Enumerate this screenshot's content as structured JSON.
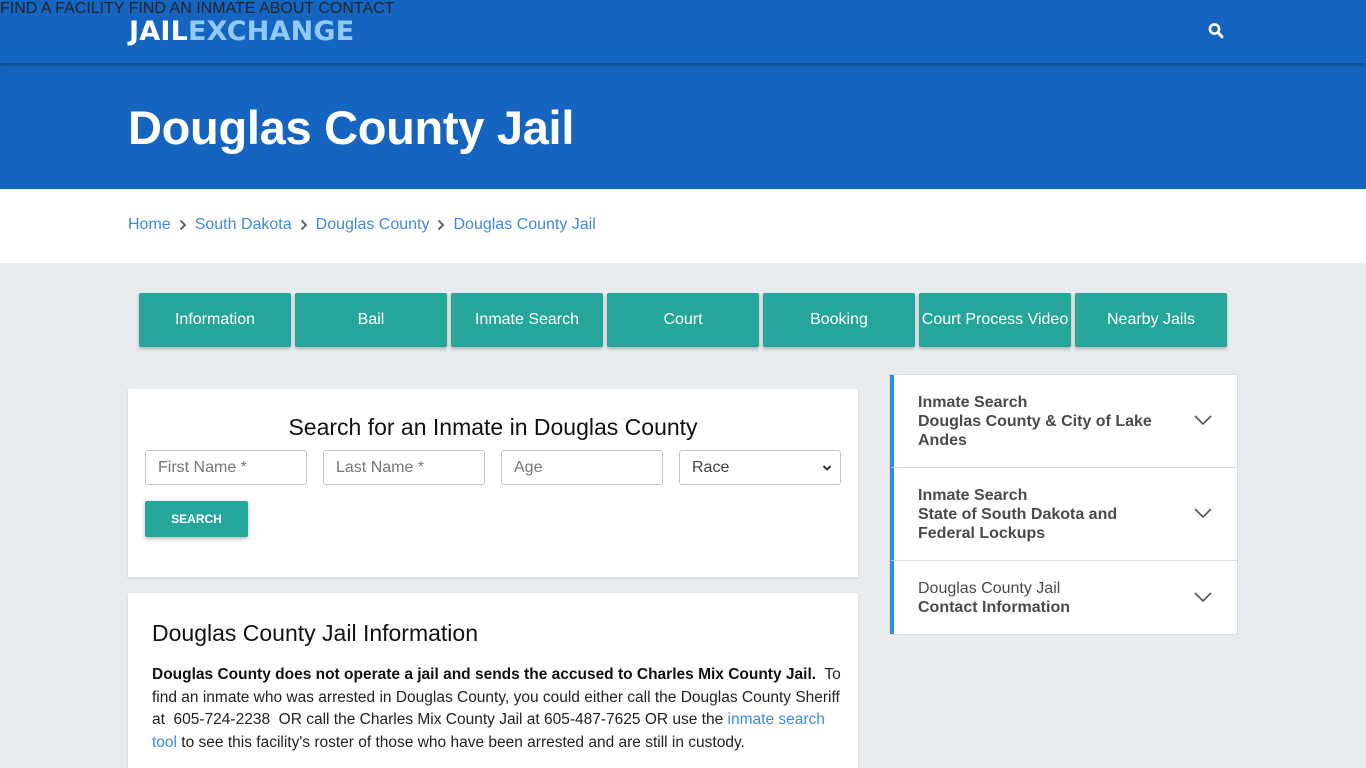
{
  "brand": {
    "part1": "JAIL",
    "part2": "EXCHANGE"
  },
  "nav": {
    "items": [
      "FIND A FACILITY",
      "FIND AN INMATE",
      "ABOUT",
      "CONTACT"
    ],
    "search_icon": "search-icon"
  },
  "hero": {
    "title": "Douglas County Jail"
  },
  "breadcrumb": [
    "Home",
    "South Dakota",
    "Douglas County",
    "Douglas County Jail"
  ],
  "tabs": [
    "Information",
    "Bail",
    "Inmate Search",
    "Court",
    "Booking",
    "Court Process Video",
    "Nearby Jails"
  ],
  "search": {
    "title": "Search for an Inmate in Douglas County",
    "first_name_placeholder": "First Name *",
    "last_name_placeholder": "Last Name *",
    "age_placeholder": "Age",
    "race_selected": "Race",
    "button_label": "SEARCH"
  },
  "info": {
    "title": "Douglas County Jail Information",
    "bold_lead": "Douglas County does not operate a jail and sends the accused to Charles Mix County Jail.",
    "text_before_link": "  To find an inmate who was arrested in Douglas County, you could either call the Douglas County Sheriff at  605-724-2238  OR call the Charles Mix County Jail at 605-487-7625 OR use the ",
    "link_text": "inmate search tool",
    "text_after_link": " to see this facility's roster of those who have been arrested and are still in custody."
  },
  "sidebar": {
    "items": [
      {
        "line1": "Inmate Search",
        "line1_bold": true,
        "line2": "Douglas County & City of Lake Andes"
      },
      {
        "line1": "Inmate Search",
        "line1_bold": true,
        "line2": "State of South Dakota and Federal Lockups"
      },
      {
        "line1": "Douglas County Jail",
        "line1_bold": false,
        "line2": "Contact Information"
      }
    ]
  },
  "colors": {
    "header_blue": "#1565c0",
    "logo_accent": "#90caf9",
    "teal_button": "#26a69a",
    "link_blue": "#3f8ad8",
    "accordion_accent": "#2d8cdb",
    "page_bg": "#e9ecef"
  }
}
